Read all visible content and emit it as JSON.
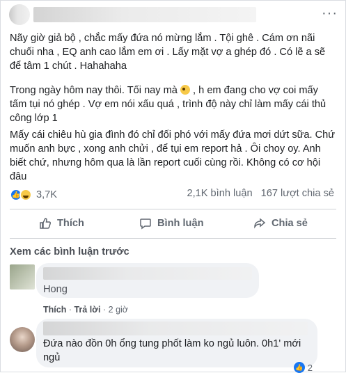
{
  "post": {
    "paragraphs": [
      "Nãy giờ giả bộ , chắc mấy đứa nó mừng lắm . Tội ghê . Cám ơn nãi chuối nha , EQ anh cao lắm em ơi . Lấy mặt vợ a ghép đó . Có lẽ a sẽ để tâm 1 chút . Hahahaha",
      "Mấy cái chiêu hù gia đình đó chỉ đối phó với mấy đứa mơi dứt sữa. Chứ muốn anh bực , xong anh chửi , để tụi em report hả . Ôi choy oy. Anh biết chứ, nhưng hôm qua là lần report cuối cùng rồi. Không có cơ hội đâu"
    ],
    "p2_before_emoji": "Trong ngày hôm nay thôi. Tối nay mà ",
    "p2_after_emoji": " , h em  đang  cho vợ coi mấy tấm tụi nó ghép . Vợ em nói xấu quá , trình độ này chỉ  làm mấy cái thủ công lớp 1",
    "more_icon": "···"
  },
  "reactions": {
    "count": "3,7K",
    "comments": "2,1K bình luận",
    "shares": "167 lượt chia sẻ"
  },
  "actions": {
    "like": "Thích",
    "comment": "Bình luận",
    "share": "Chia sẻ"
  },
  "comments_section": {
    "view_previous": "Xem các bình luận trước",
    "comment1": {
      "text": "Hong",
      "like": "Thích",
      "reply": "Trả lời",
      "time": "2 giờ"
    },
    "comment2": {
      "text": "Đứa nào đồn 0h ổng tung phốt làm ko ngủ luôn. 0h1' mới ngủ",
      "likes": "2"
    }
  },
  "colors": {
    "accent": "#1877f2",
    "muted": "#606770",
    "bubble": "#f0f2f5"
  }
}
